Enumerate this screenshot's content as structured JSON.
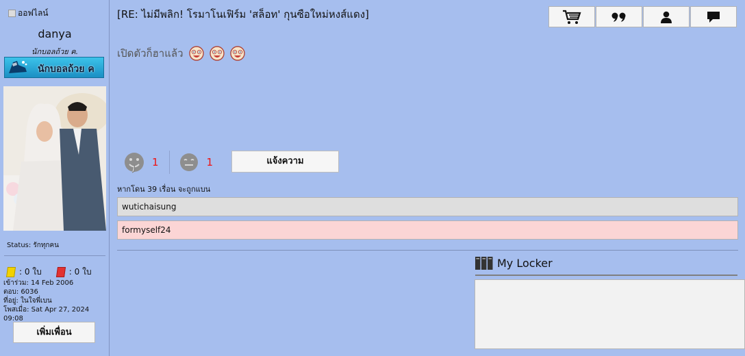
{
  "user": {
    "online_status": "ออฟไลน์",
    "name": "danya",
    "title": "นักบอลถ้วย ค.",
    "rank_badge": "นักบอลถ้วย ค",
    "status_text": "Status: รักทุกคน",
    "yellow_cards": ": 0 ใบ",
    "red_cards": ": 0 ใบ",
    "joined": "เข้าร่วม: 14 Feb 2006",
    "replies": "ตอบ: 6036",
    "location": "ที่อยู่: ในใจพี่เบน",
    "last_post": "โพสเมื่อ: Sat Apr 27, 2024 09:08",
    "add_friend": "เพิ่มเพื่อน"
  },
  "post": {
    "title": "[RE: ไม่มีพลิก! โรมาโนเฟิร์ม 'สล็อท' กุนซือใหม่หงส์แดง]",
    "body": "เปิดตัวก็ฮาแล้ว",
    "smileys": [
      "laughing-smiley-icon",
      "laughing-smiley-icon",
      "laughing-smiley-icon"
    ],
    "like_count": "1",
    "dislike_count": "1",
    "report_button": "แจ้งความ",
    "ban_note": "หากโดน 39 เรื่อน จะถูกแบน",
    "voters": [
      "wutichaisung",
      "formyself24"
    ]
  },
  "toolbar": {
    "icons": [
      "cart-icon",
      "quote-icon",
      "user-icon",
      "comment-icon"
    ]
  },
  "locker": {
    "title": "My Locker"
  },
  "colors": {
    "background": "#a6beee",
    "report_count": "#ee1111",
    "voter_pink": "#fbd5d5",
    "voter_grey": "#dedede"
  }
}
